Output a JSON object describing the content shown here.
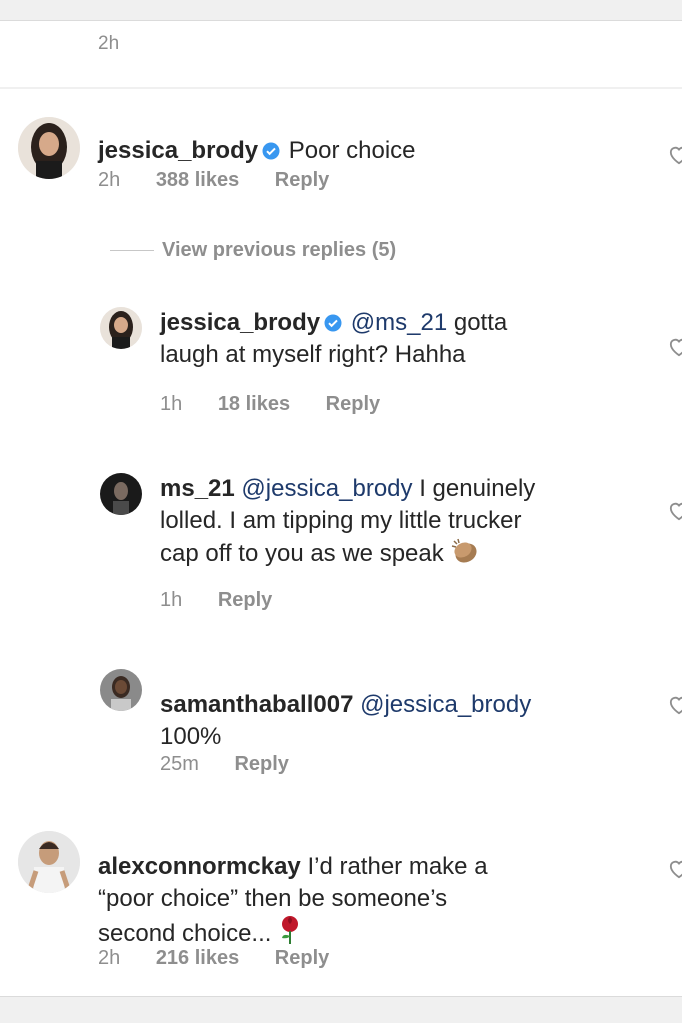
{
  "top": {
    "time": "2h"
  },
  "comments": [
    {
      "username": "jessica_brody",
      "verified": true,
      "text": "Poor choice",
      "time": "2h",
      "likes": "388 likes",
      "reply": "Reply"
    },
    {
      "username": "jessica_brody",
      "verified": true,
      "mention": "@ms_21",
      "text_line1": "gotta",
      "text_line2": "laugh at myself right? Hahha",
      "time": "1h",
      "likes": "18 likes",
      "reply": "Reply"
    },
    {
      "username": "ms_21",
      "mention": "@jessica_brody",
      "text_line1": "I genuinely",
      "text_line2": "lolled. I am tipping my little trucker",
      "text_line3": "cap off to you as we speak",
      "emoji": "clapping-hands-emoji",
      "time": "1h",
      "reply": "Reply"
    },
    {
      "username": "samanthaball007",
      "mention": "@jessica_brody",
      "text_line2": "100%",
      "time": "25m",
      "reply": "Reply"
    },
    {
      "username": "alexconnormckay",
      "text_line1": "I’d rather make a",
      "text_line2": "“poor choice” then be someone’s",
      "text_line3": "second choice...",
      "emoji": "rose-emoji",
      "time": "2h",
      "likes": "216 likes",
      "reply": "Reply"
    }
  ],
  "view_previous": "View previous replies (5)",
  "colors": {
    "meta": "#8e8e8e",
    "text": "#262626",
    "mention": "#1e3a6b",
    "verified": "#3897f0"
  },
  "icons": [
    "verified-badge-icon",
    "heart-outline-icon"
  ]
}
